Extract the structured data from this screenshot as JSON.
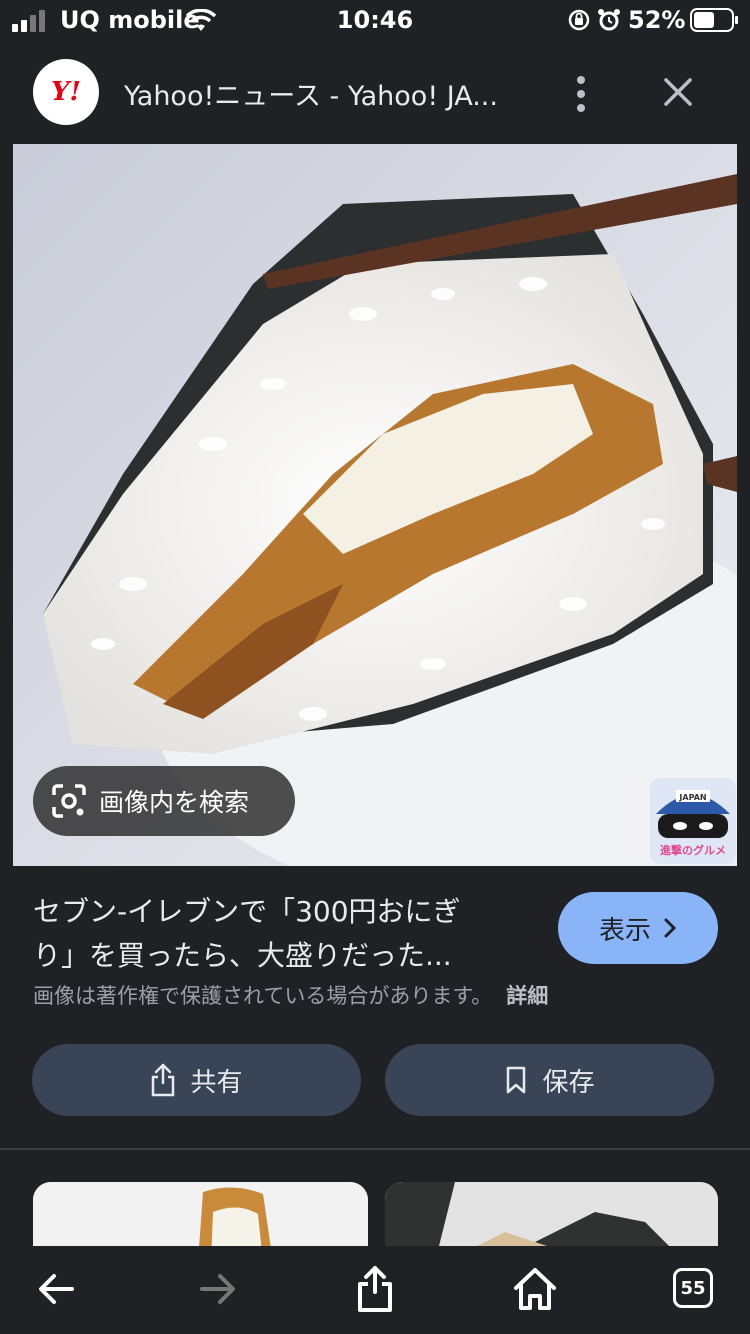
{
  "status_bar": {
    "carrier": "UQ mobile",
    "time": "10:46",
    "battery": "52%"
  },
  "header": {
    "logo_text": "Y!",
    "title": "Yahoo!ニュース - Yahoo! JA..."
  },
  "viewer": {
    "lens_label": "画像内を検索",
    "watermark_top": "JAPAN",
    "watermark_bottom": "進撃のグルメ"
  },
  "info": {
    "title_line1": "セブン-イレブンで「300円おにぎ",
    "title_line2": "り」を買ったら、大盛りだった...",
    "view_button": "表示",
    "copyright": "画像は著作権で保護されている場合があります。",
    "details_link": "詳細"
  },
  "actions": {
    "share_label": "共有",
    "save_label": "保存"
  },
  "toolbar": {
    "tab_count": "55"
  },
  "colors": {
    "background": "#202124",
    "accent_button": "#8ab4f8",
    "action_button": "#394457",
    "brand_red": "#e60012"
  }
}
